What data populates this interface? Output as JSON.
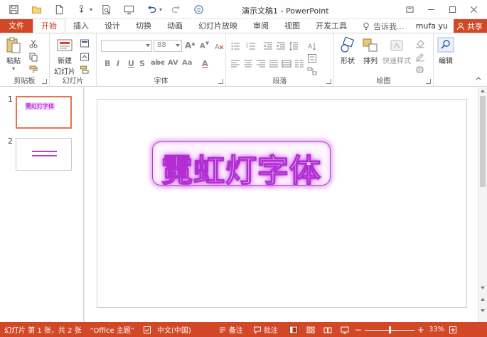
{
  "window": {
    "title": "演示文稿1 - PowerPoint"
  },
  "tabs": {
    "file": "文件",
    "home": "开始",
    "insert": "插入",
    "design": "设计",
    "transitions": "切换",
    "animations": "动画",
    "slideshow": "幻灯片放映",
    "review": "审阅",
    "view": "视图",
    "developer": "开发工具",
    "tell_me": "告诉我...",
    "user": "mufa yu",
    "share": "共享"
  },
  "ribbon": {
    "clipboard": {
      "paste": "粘贴",
      "label": "剪贴板"
    },
    "slides": {
      "new_slide_line1": "新建",
      "new_slide_line2": "幻灯片",
      "label": "幻灯片"
    },
    "font": {
      "size": "88",
      "label": "字体"
    },
    "paragraph": {
      "label": "段落"
    },
    "drawing": {
      "shapes": "形状",
      "arrange": "排列",
      "quick_styles": "快速样式",
      "label": "绘图"
    },
    "editing": {
      "label": "编辑"
    }
  },
  "slides": [
    {
      "number": "1",
      "thumb_text": "霓虹灯字体"
    },
    {
      "number": "2"
    }
  ],
  "slide": {
    "text": "霓虹灯字体"
  },
  "statusbar": {
    "slide_info": "幻灯片 第 1 张，共 2 张",
    "theme": "“Office 主题”",
    "language": "中文(中国)",
    "notes": "备注",
    "comments": "批注",
    "zoom": "33%"
  },
  "colors": {
    "accent": "#d24726",
    "neon_stroke": "#b12ed0",
    "neon_glow": "#d060f0"
  }
}
